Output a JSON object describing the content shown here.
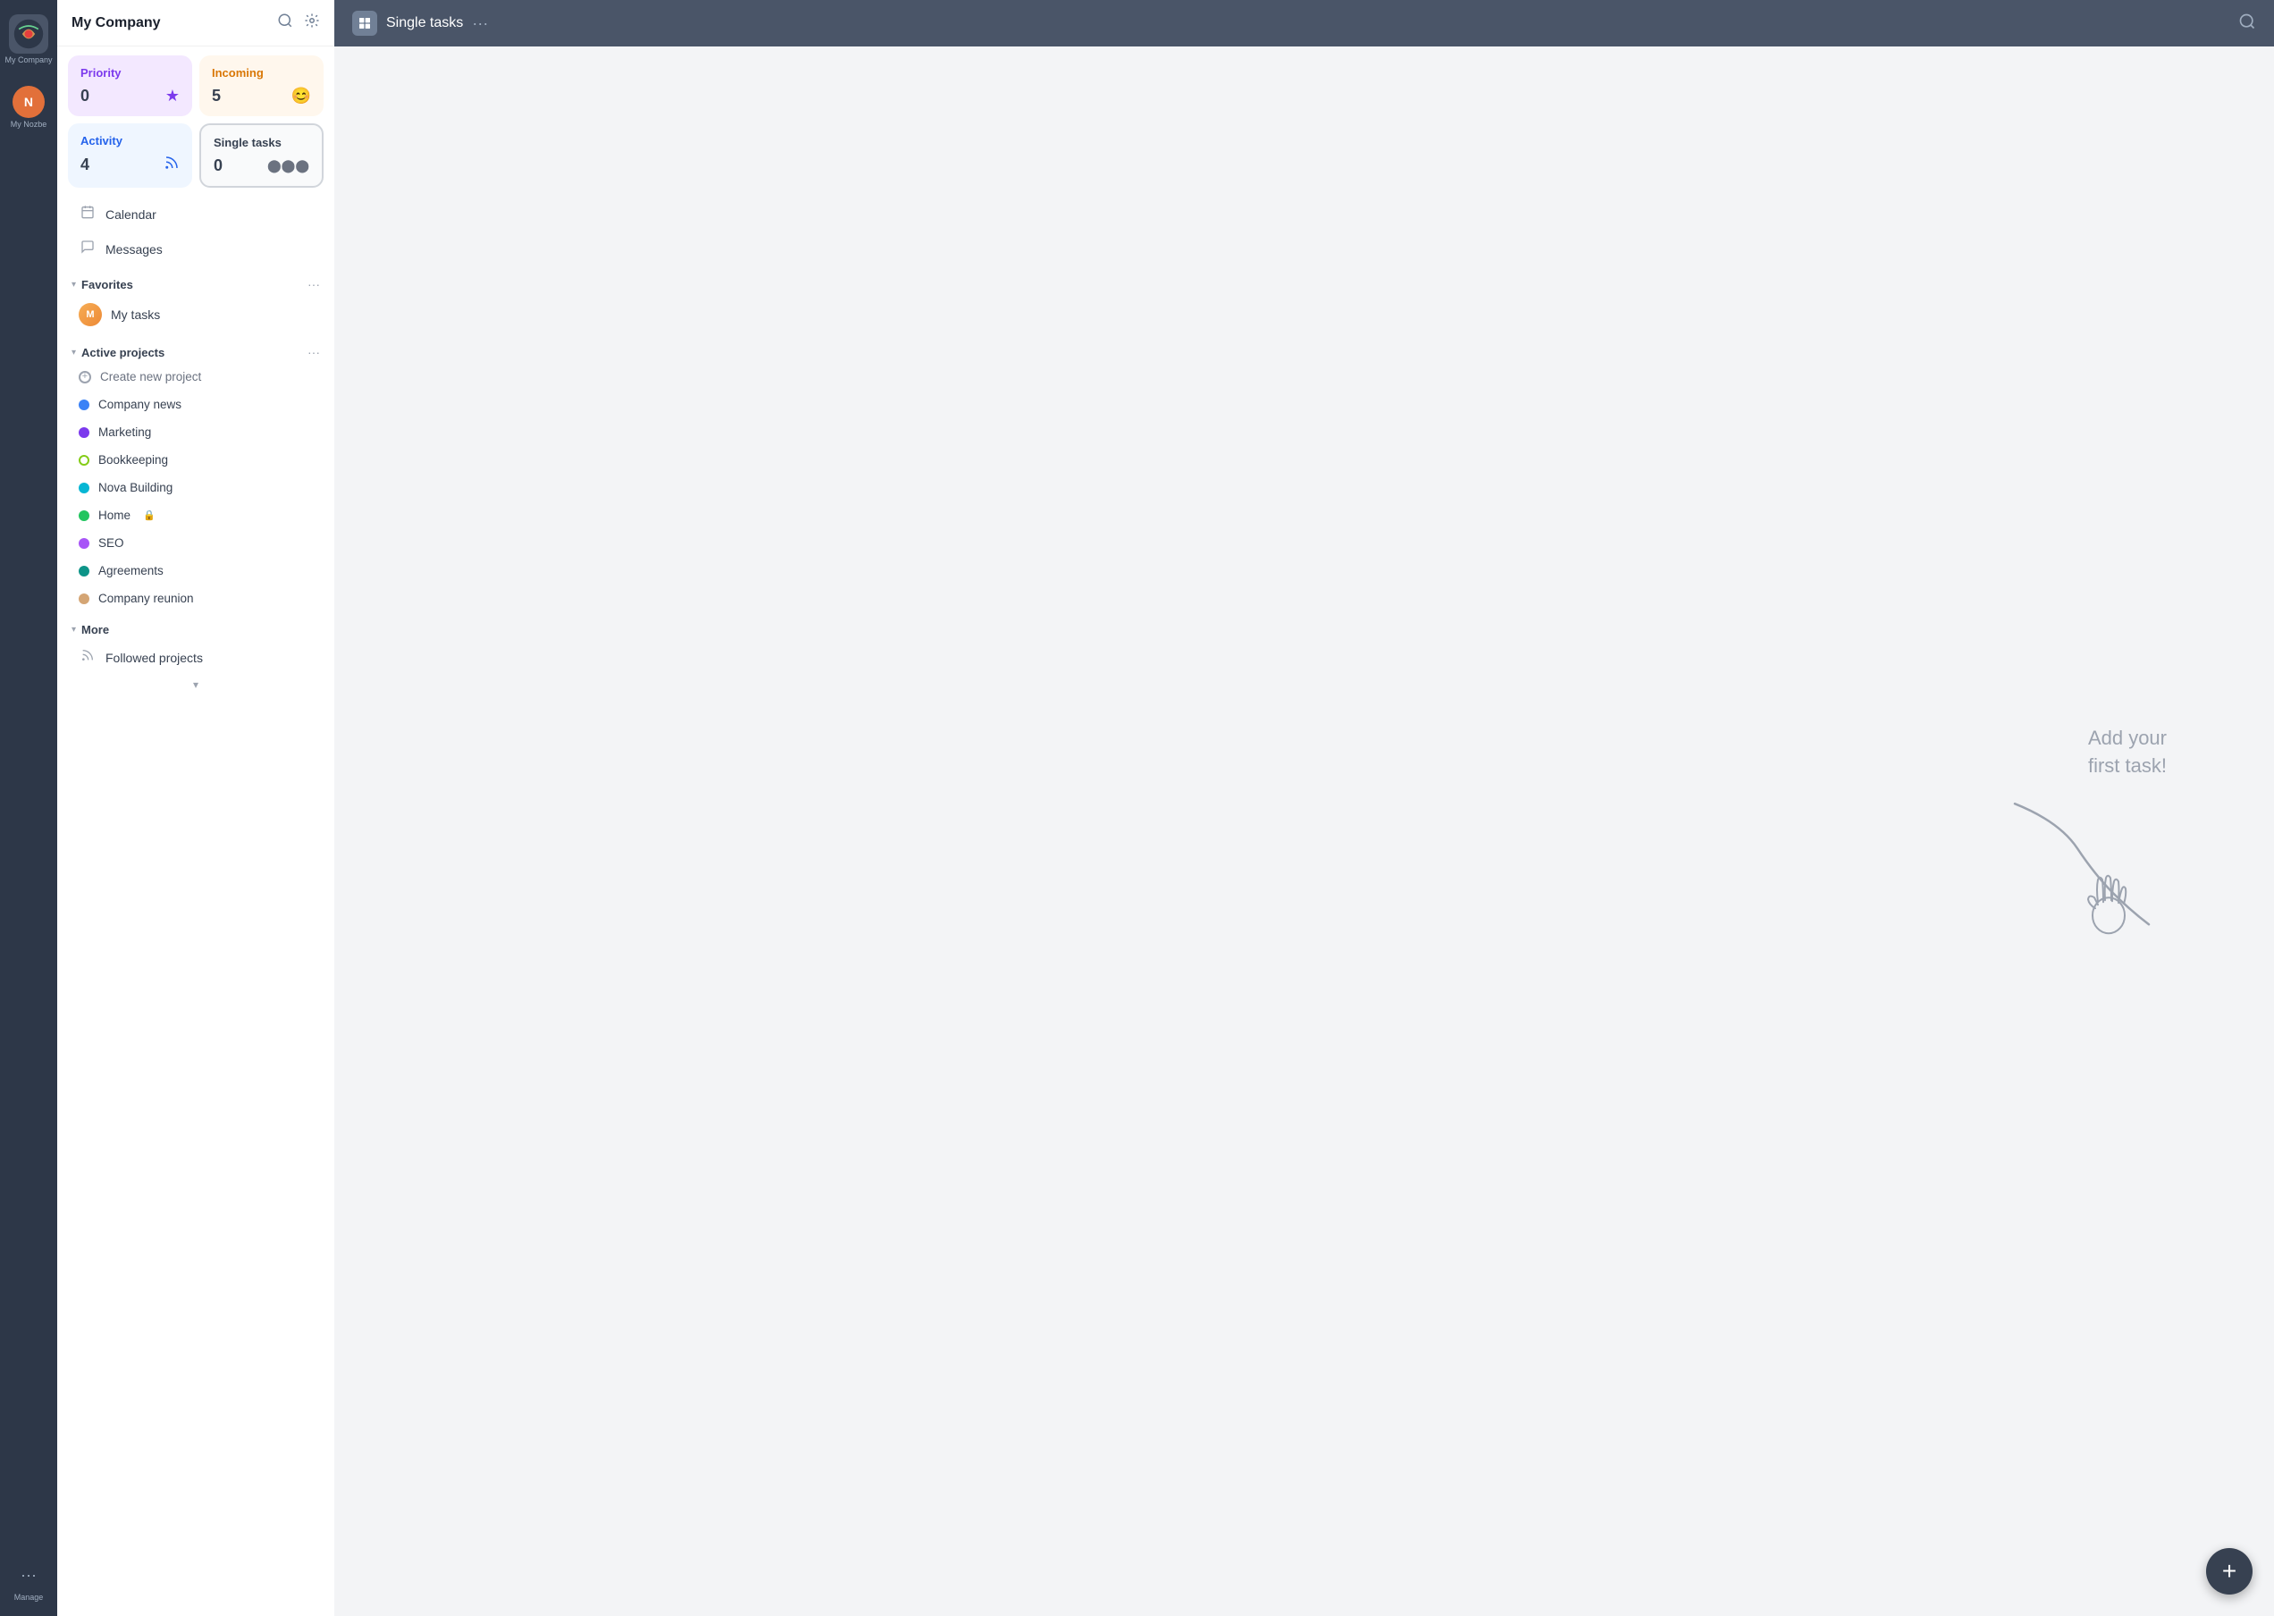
{
  "iconBar": {
    "appName": "My Company",
    "manageLabel": "Manage"
  },
  "sidebar": {
    "title": "My Company",
    "searchLabel": "Search",
    "settingsLabel": "Settings",
    "quickCards": [
      {
        "id": "priority",
        "label": "Priority",
        "count": "0",
        "icon": "★",
        "theme": "priority"
      },
      {
        "id": "incoming",
        "label": "Incoming",
        "count": "5",
        "icon": "😊",
        "theme": "incoming"
      },
      {
        "id": "activity",
        "label": "Activity",
        "count": "4",
        "icon": "📡",
        "theme": "activity"
      },
      {
        "id": "single-tasks",
        "label": "Single tasks",
        "count": "0",
        "icon": "●●●",
        "theme": "single-tasks"
      }
    ],
    "navItems": [
      {
        "id": "calendar",
        "icon": "📅",
        "label": "Calendar"
      },
      {
        "id": "messages",
        "icon": "💬",
        "label": "Messages"
      }
    ],
    "favoritesSection": {
      "label": "Favorites",
      "items": [
        {
          "id": "my-tasks",
          "label": "My tasks"
        }
      ]
    },
    "activeProjectsSection": {
      "label": "Active projects",
      "items": [
        {
          "id": "create-new",
          "label": "Create new project",
          "dot": null,
          "isCreate": true
        },
        {
          "id": "company-news",
          "label": "Company news",
          "dot": "#3b82f6"
        },
        {
          "id": "marketing",
          "label": "Marketing",
          "dot": "#7c3aed"
        },
        {
          "id": "bookkeeping",
          "label": "Bookkeeping",
          "dot": "#84cc16"
        },
        {
          "id": "nova-building",
          "label": "Nova Building",
          "dot": "#06b6d4"
        },
        {
          "id": "home",
          "label": "Home",
          "dot": "#22c55e",
          "lock": true
        },
        {
          "id": "seo",
          "label": "SEO",
          "dot": "#a855f7"
        },
        {
          "id": "agreements",
          "label": "Agreements",
          "dot": "#0d9488"
        },
        {
          "id": "company-reunion",
          "label": "Company reunion",
          "dot": "#d4a574"
        }
      ]
    },
    "moreSection": {
      "label": "More",
      "items": [
        {
          "id": "followed-projects",
          "label": "Followed projects"
        }
      ]
    }
  },
  "mainHeader": {
    "title": "Single tasks",
    "moreLabel": "More options",
    "searchLabel": "Search"
  },
  "mainContent": {
    "emptyState": {
      "line1": "Add your",
      "line2": "first task!"
    }
  },
  "fab": {
    "label": "+"
  }
}
